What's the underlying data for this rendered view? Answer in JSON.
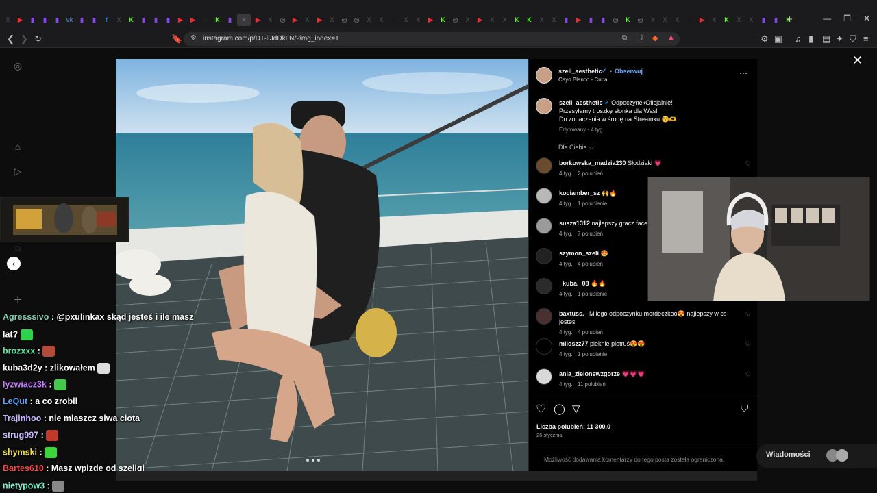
{
  "browser": {
    "url": "instagram.com/p/DT-iIJdDkLN/?img_index=1",
    "tabs": [
      "x",
      "yt",
      "tw",
      "tw",
      "tw",
      "vk",
      "tw",
      "tw",
      "fb",
      "x",
      "k",
      "tw",
      "tw",
      "tw",
      "yt",
      "yt",
      "b",
      "k",
      "tw",
      "g",
      "yt",
      "x",
      "g",
      "yt",
      "x",
      "yt",
      "x",
      "g",
      "g",
      "x",
      "x",
      "tk",
      "x",
      "x",
      "yt",
      "k",
      "g",
      "x",
      "yt",
      "x",
      "x",
      "k",
      "k",
      "x",
      "x",
      "tw",
      "yt",
      "tw",
      "tw",
      "g",
      "k",
      "g",
      "x",
      "x",
      "x",
      "tk",
      "yt",
      "x",
      "k",
      "x",
      "x",
      "tw",
      "tw",
      "k"
    ]
  },
  "post": {
    "author": "szeli_aesthetic",
    "follow_label": "Obserwuj",
    "location": "Cayo Blanco - Cuba",
    "caption_line1": "OdpoczynekOficjalnie!",
    "caption_line2": "Przesyłamy troszkę słonka dla Was!",
    "caption_line3": "Do zobaczenia w środę na Streamku 😚🫶",
    "edited": "Edytowany · 4 tyg.",
    "filter_label": "Dla Ciebie",
    "likes": "Liczba polubień: 11 300,0",
    "date": "26 stycznia",
    "comments_limited": "Możliwość dodawania komentarzy do tego posta została ograniczona."
  },
  "comments": [
    {
      "user": "borkowska_madzia230",
      "text": "Słodziaki 💗",
      "time": "4 tyg.",
      "likes": "2 polubień"
    },
    {
      "user": "kociamber_sz",
      "text": "🙌🔥",
      "time": "4 tyg.",
      "likes": "1 polubienie"
    },
    {
      "user": "susza1312",
      "text": "najlepszy gracz faceit",
      "time": "4 tyg.",
      "likes": "7 polubień"
    },
    {
      "user": "szymon_szeli",
      "text": "😍",
      "time": "4 tyg.",
      "likes": "4 polubień"
    },
    {
      "user": "_kuba._08",
      "text": "🔥🔥",
      "time": "4 tyg.",
      "likes": "1 polubienie"
    },
    {
      "user": "baxtuss._",
      "text": "Milego odpoczynku mordeczkoo😍 najlepszy w cs jestes",
      "time": "4 tyg.",
      "likes": "4 polubień"
    },
    {
      "user": "miloszz77",
      "text": "pieknie piotruś😍😍",
      "time": "4 tyg.",
      "likes": "1 polubienie"
    },
    {
      "user": "ania_zielonewzgorze",
      "text": "💗💗💗",
      "time": "4 tyg.",
      "likes": "11 polubień"
    }
  ],
  "chat": [
    {
      "user": "Agresssivo",
      "color": "#7ecfb0",
      "text": ": @pxulinkax skąd jesteś i ile masz"
    },
    {
      "user": "",
      "color": "#fff",
      "text": "lat?"
    },
    {
      "user": "brozxxx",
      "color": "#5de8a0",
      "text": ":"
    },
    {
      "user": "kuba3d2y",
      "color": "#ffffff",
      "text": ": zlikowałem"
    },
    {
      "user": "lyzwiacz3k",
      "color": "#c77dff",
      "text": ":"
    },
    {
      "user": "LeQut",
      "color": "#5fa8ff",
      "text": ": a co zrobil"
    },
    {
      "user": "Trajinhoo",
      "color": "#c7b8ff",
      "text": ": nie mlaszcz siwa ciota"
    },
    {
      "user": "strug997",
      "color": "#c7b8ff",
      "text": ":"
    },
    {
      "user": "shymski",
      "color": "#f5e04a",
      "text": ":"
    },
    {
      "user": "Bartes610",
      "color": "#ff4747",
      "text": ": Masz wpizde od szeligi"
    },
    {
      "user": "nietypow3",
      "color": "#7ef0d0",
      "text": ":"
    }
  ],
  "messages_label": "Wiadomości",
  "colors": {
    "accent": "#0095f6",
    "heart": "#ff2f72"
  }
}
